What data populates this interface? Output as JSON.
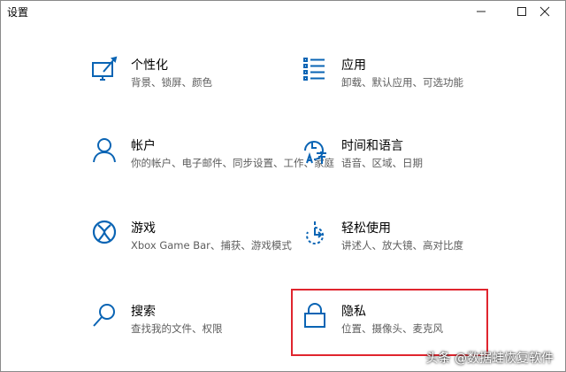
{
  "window": {
    "title": "设置",
    "minimize_icon": "minimize-icon",
    "maximize_icon": "maximize-icon",
    "close_icon": "close-icon"
  },
  "accent_color": "#0a64b4",
  "tiles": [
    {
      "label": "个性化",
      "desc_lines": [
        "背景、锁屏、颜色"
      ],
      "icon": "personalization-icon"
    },
    {
      "label": "应用",
      "desc_lines": [
        "卸载、默认应用、可选功能"
      ],
      "icon": "apps-icon"
    },
    {
      "label": "帐户",
      "desc_lines": [
        "你的帐户、电子邮件、同步设置、工作、家庭"
      ],
      "icon": "accounts-icon"
    },
    {
      "label": "时间和语言",
      "desc_lines": [
        "语音、区域、日期"
      ],
      "icon": "time-language-icon"
    },
    {
      "label": "游戏",
      "desc_lines": [
        "Xbox Game Bar、捕获、游戏模式"
      ],
      "icon": "gaming-icon"
    },
    {
      "label": "轻松使用",
      "desc_lines": [
        "讲述人、放大镜、高对比度"
      ],
      "icon": "ease-of-access-icon"
    },
    {
      "label": "搜索",
      "desc_lines": [
        "查找我的文件、权限"
      ],
      "icon": "search-icon"
    },
    {
      "label": "隐私",
      "desc_lines": [
        "位置、摄像头、麦克风"
      ],
      "icon": "privacy-lock-icon"
    }
  ],
  "watermark": "头条 @数据蛙恢复软件"
}
